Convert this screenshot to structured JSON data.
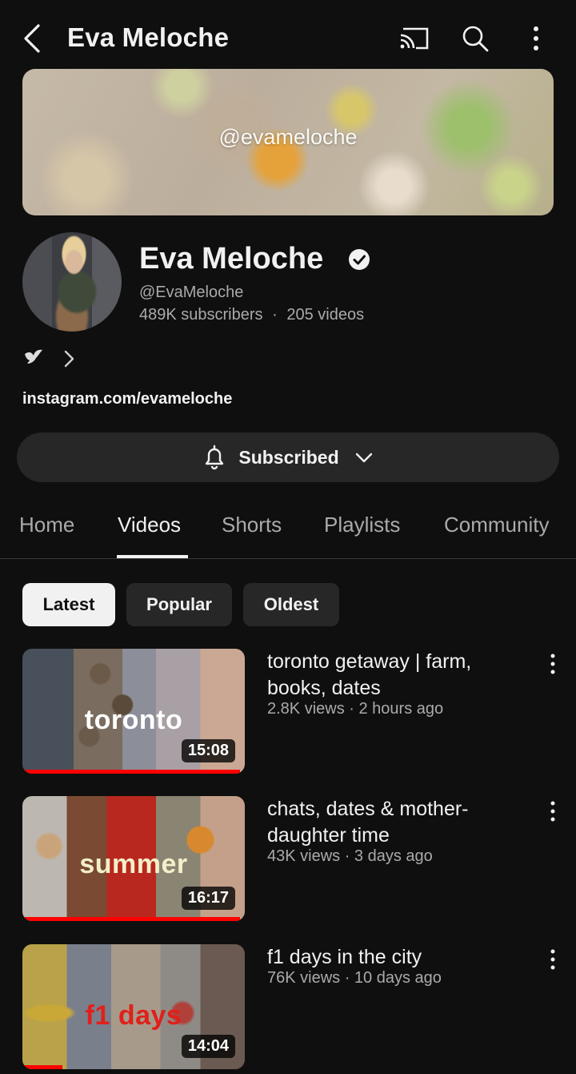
{
  "header": {
    "title": "Eva Meloche"
  },
  "banner": {
    "handle": "@evameloche"
  },
  "channel": {
    "name": "Eva Meloche",
    "handle": "@EvaMeloche",
    "subscribers": "489K subscribers",
    "separator": "·",
    "videos_count": "205 videos",
    "link": "instagram.com/evameloche",
    "subscribe_label": "Subscribed"
  },
  "tabs": [
    {
      "label": "Home"
    },
    {
      "label": "Videos"
    },
    {
      "label": "Shorts"
    },
    {
      "label": "Playlists"
    },
    {
      "label": "Community"
    }
  ],
  "active_tab": "Videos",
  "chips": [
    {
      "label": "Latest"
    },
    {
      "label": "Popular"
    },
    {
      "label": "Oldest"
    }
  ],
  "active_chip": "Latest",
  "videos": [
    {
      "title": "toronto getaway | farm, books, dates",
      "meta": "2.8K views · 2 hours ago",
      "duration": "15:08",
      "thumb_text": "toronto",
      "progress": 0.98
    },
    {
      "title": "chats, dates & mother-daughter time",
      "meta": "43K views · 3 days ago",
      "duration": "16:17",
      "thumb_text": "summer",
      "progress": 0.98
    },
    {
      "title": "f1 days in the city",
      "meta": "76K views · 10 days ago",
      "duration": "14:04",
      "thumb_text": "f1 days",
      "progress": 0.18
    }
  ],
  "colors": {
    "background": "#0f0f0f",
    "secondary_text": "#aaaaaa",
    "button_bg": "#272727",
    "progress": "#ff0000"
  },
  "icons": [
    "back-arrow-icon",
    "cast-icon",
    "search-icon",
    "more-vert-icon",
    "verified-check-icon",
    "dove-icon",
    "chevron-right-icon",
    "bell-icon",
    "chevron-down-icon"
  ]
}
